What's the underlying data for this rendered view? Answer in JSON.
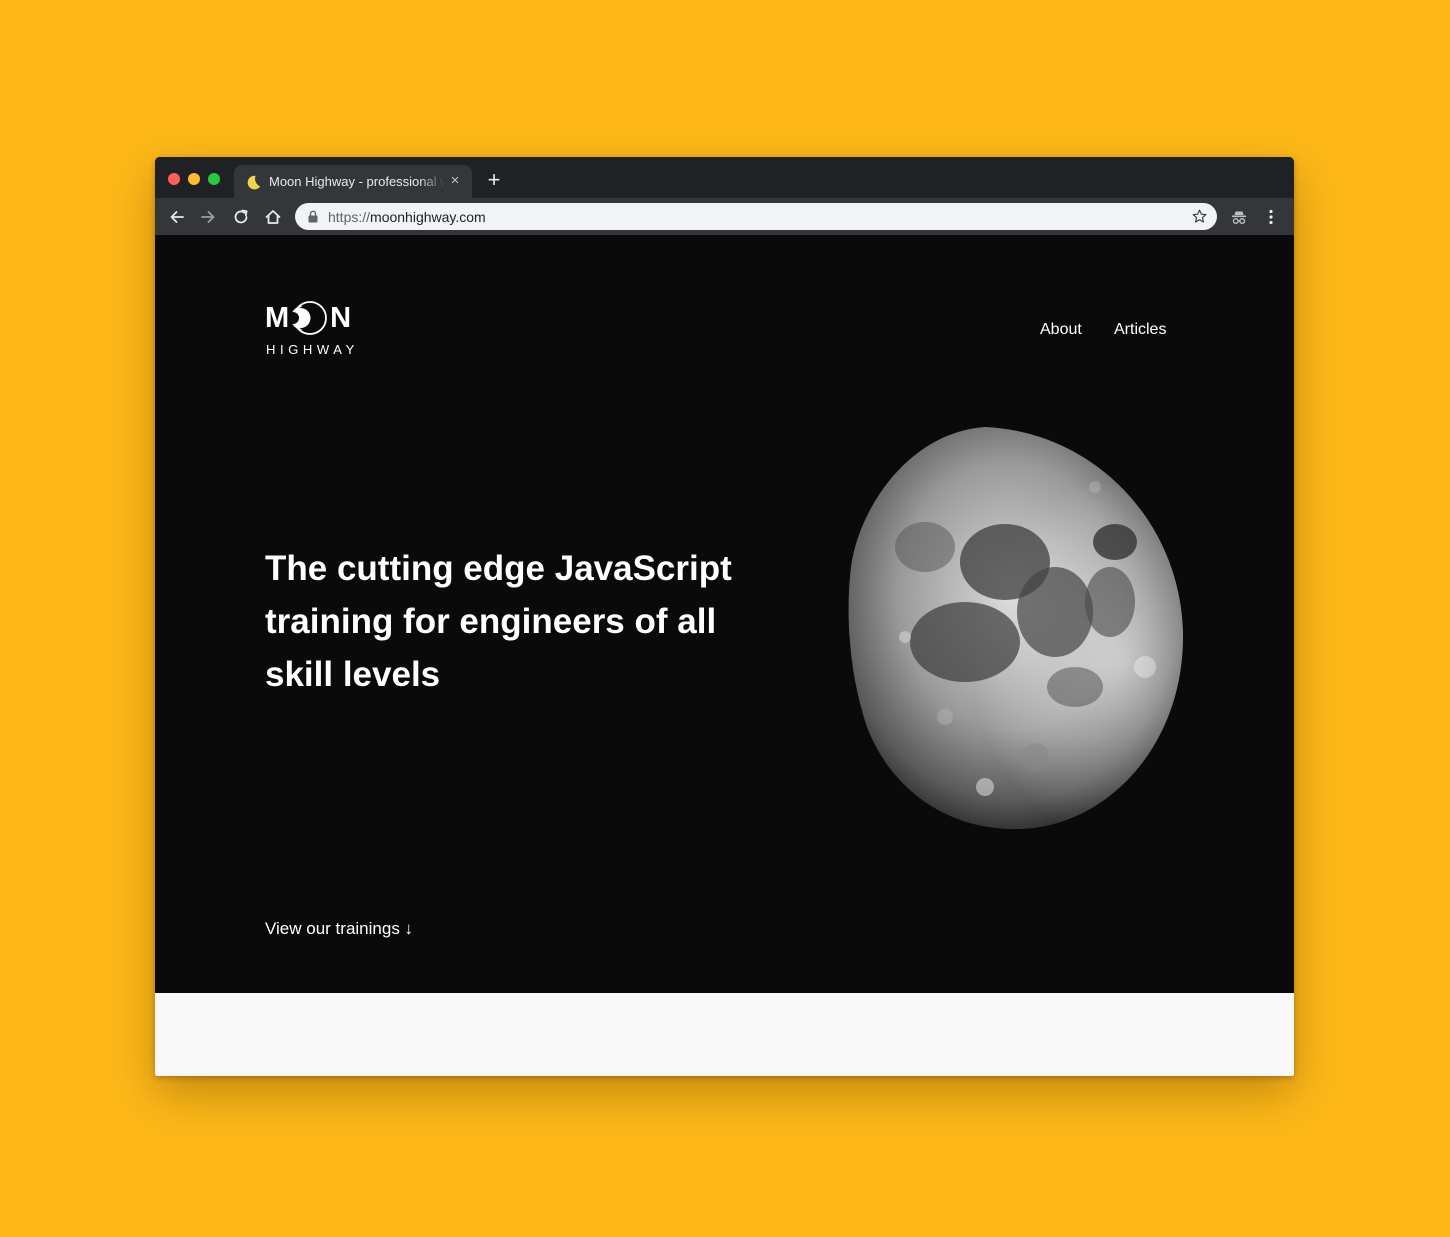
{
  "browser": {
    "tab_title": "Moon Highway - professional web development training",
    "url_scheme": "https://",
    "url_host": "moonhighway.com",
    "new_tab_glyph": "+",
    "close_glyph": "×"
  },
  "site": {
    "logo_top_left": "M",
    "logo_top_right": "N",
    "logo_bottom": "HIGHWAY",
    "nav": {
      "about": "About",
      "articles": "Articles"
    },
    "headline": "The cutting edge JavaScript training for engineers of all skill levels",
    "cta": "View our trainings ↓"
  },
  "colors": {
    "backdrop": "#FDB818",
    "hero_bg": "#0a0a0a",
    "text": "#ffffff",
    "tab_bar": "#202124",
    "toolbar": "#35363a"
  },
  "icons": [
    "moon-favicon-icon",
    "close-icon",
    "plus-icon",
    "back-arrow-icon",
    "forward-arrow-icon",
    "reload-icon",
    "home-icon",
    "lock-icon",
    "star-icon",
    "incognito-icon",
    "kebab-menu-icon"
  ]
}
